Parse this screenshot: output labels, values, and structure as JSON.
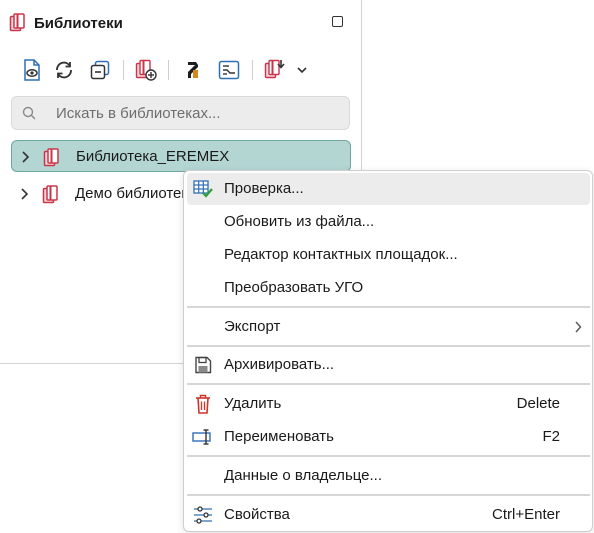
{
  "panel": {
    "title": "Библиотеки",
    "logo_icon": "library-books-icon",
    "search_placeholder": "Искать в библиотеках...",
    "toolbar": [
      {
        "icon": "view-document-icon"
      },
      {
        "icon": "refresh-icon"
      },
      {
        "icon": "collapse-all-icon"
      },
      {
        "icon": "add-library-icon"
      },
      {
        "icon": "eremex-logo-icon"
      },
      {
        "icon": "component-editor-icon"
      },
      {
        "icon": "import-library-icon"
      },
      {
        "icon": "chevron-down-icon"
      }
    ],
    "tree": [
      {
        "label": "Библиотека_EREMEX",
        "selected": true
      },
      {
        "label": "Демо библиотека",
        "selected": false
      }
    ]
  },
  "context_menu": {
    "items": [
      {
        "label": "Проверка...",
        "icon": "check-table-icon",
        "shortcut": ""
      },
      {
        "label": "Обновить из файла...",
        "icon": "",
        "shortcut": ""
      },
      {
        "label": "Редактор контактных площадок...",
        "icon": "",
        "shortcut": ""
      },
      {
        "label": "Преобразовать УГО",
        "icon": "",
        "shortcut": ""
      },
      {
        "label": "Экспорт",
        "icon": "",
        "shortcut": "",
        "submenu": true
      },
      {
        "label": "Архивировать...",
        "icon": "save-archive-icon",
        "shortcut": ""
      },
      {
        "label": "Удалить",
        "icon": "trash-icon",
        "shortcut": "Delete"
      },
      {
        "label": "Переименовать",
        "icon": "rename-icon",
        "shortcut": "F2"
      },
      {
        "label": "Данные о владельце...",
        "icon": "",
        "shortcut": ""
      },
      {
        "label": "Свойства",
        "icon": "settings-sliders-icon",
        "shortcut": "Ctrl+Enter"
      }
    ]
  },
  "colors": {
    "selection_bg": "#b3d6d3",
    "selection_border": "#6fa8a3",
    "library_red": "#c9364a",
    "check_green": "#2f9e3a",
    "delete_red": "#d0352a",
    "icon_blue": "#2f6fb5"
  }
}
